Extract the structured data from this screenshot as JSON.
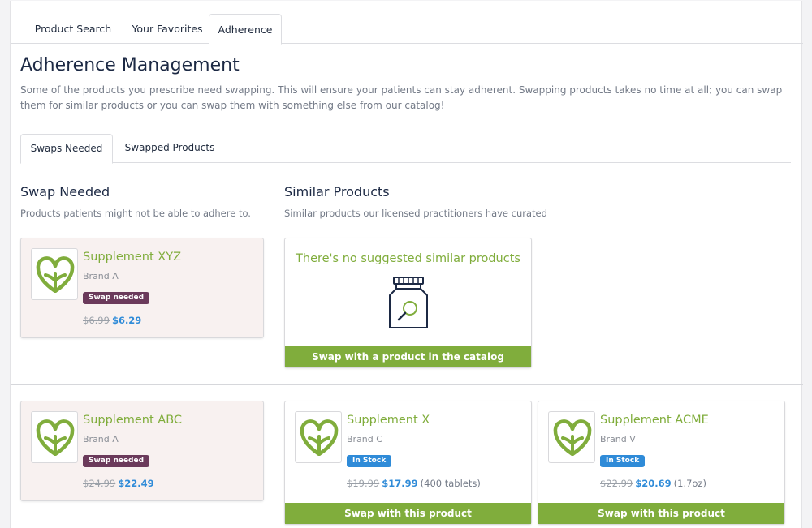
{
  "top_tabs": [
    "Product Search",
    "Your Favorites",
    "Adherence"
  ],
  "page": {
    "title": "Adherence Management",
    "description": "Some of the products you prescribe need swapping. This will ensure your patients can stay adherent. Swapping products takes no time at all; you can swap them for similar products or you can swap them with something else from our catalog!"
  },
  "sub_tabs": [
    "Swaps Needed",
    "Swapped Products"
  ],
  "swap_section": {
    "title": "Swap Needed",
    "subtitle": "Products patients might not be able to adhere to."
  },
  "similar_section": {
    "title": "Similar Products",
    "subtitle": "Similar products our licensed practitioners have curated"
  },
  "rows": [
    {
      "needed": {
        "name": "Supplement XYZ",
        "brand": "Brand A",
        "badge": "Swap needed",
        "old_price": "$6.99",
        "new_price": "$6.29"
      },
      "empty": {
        "message": "There's no suggested similar products",
        "button": "Swap with a product in the catalog",
        "icon": "bottle-search-icon"
      }
    },
    {
      "needed": {
        "name": "Supplement ABC",
        "brand": "Brand A",
        "badge": "Swap needed",
        "old_price": "$24.99",
        "new_price": "$22.49"
      },
      "similar": [
        {
          "name": "Supplement X",
          "brand": "Brand C",
          "badge": "In Stock",
          "old_price": "$19.99",
          "new_price": "$17.99",
          "size": "(400 tablets)",
          "button": "Swap with this product"
        },
        {
          "name": "Supplement ACME",
          "brand": "Brand V",
          "badge": "In Stock",
          "old_price": "$22.99",
          "new_price": "$20.69",
          "size": "(1.7oz)",
          "button": "Swap with this product"
        }
      ]
    }
  ],
  "colors": {
    "accent_green": "#80ad3c",
    "swap_badge": "#6b3a5b",
    "stock_badge": "#2f8bd8",
    "price_blue": "#2f8bd8"
  }
}
